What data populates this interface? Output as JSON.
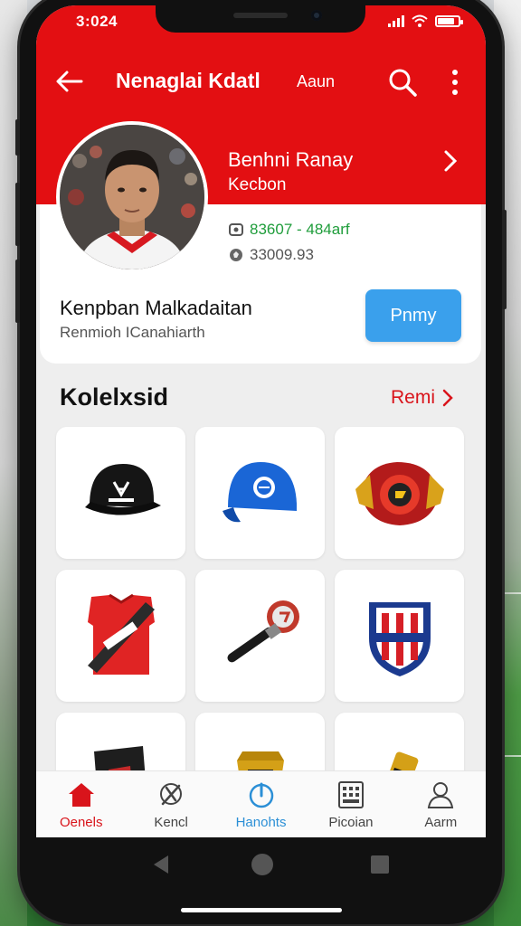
{
  "status_bar": {
    "time": "3:024"
  },
  "app_bar": {
    "title": "Nenaglai Kdatl",
    "subtitle": "Aaun"
  },
  "profile": {
    "name": "Benhni Ranay",
    "role": "Kecbon",
    "stat_primary": "83607 - 484arf",
    "stat_secondary": "33009.93",
    "card_title": "Kenpban Malkadaitan",
    "card_subtitle": "Renmioh ICanahiarth",
    "action_button": "Pnmy"
  },
  "collection": {
    "title": "Kolelxsid",
    "see_all": "Remi",
    "items": [
      {
        "name": "black-cap"
      },
      {
        "name": "blue-cap"
      },
      {
        "name": "football-badge"
      },
      {
        "name": "red-scarf-jersey"
      },
      {
        "name": "stick-item"
      },
      {
        "name": "jersey-crest"
      },
      {
        "name": "bag-item"
      },
      {
        "name": "trophy-item"
      },
      {
        "name": "whistle-item"
      }
    ]
  },
  "bottom_nav": [
    {
      "label": "Oenels",
      "icon": "home-icon",
      "active": true
    },
    {
      "label": "Kencl",
      "icon": "wrench-icon",
      "active": false
    },
    {
      "label": "Hanohts",
      "icon": "bell-icon",
      "active": false
    },
    {
      "label": "Picoian",
      "icon": "calculator-icon",
      "active": false
    },
    {
      "label": "Aarm",
      "icon": "person-icon",
      "active": false
    }
  ],
  "colors": {
    "brand_red": "#e30f12",
    "accent_blue": "#3aa0ec",
    "stat_green": "#1f9d3b",
    "nav_active": "#d9141b",
    "nav_highlight": "#2b8fd6"
  }
}
